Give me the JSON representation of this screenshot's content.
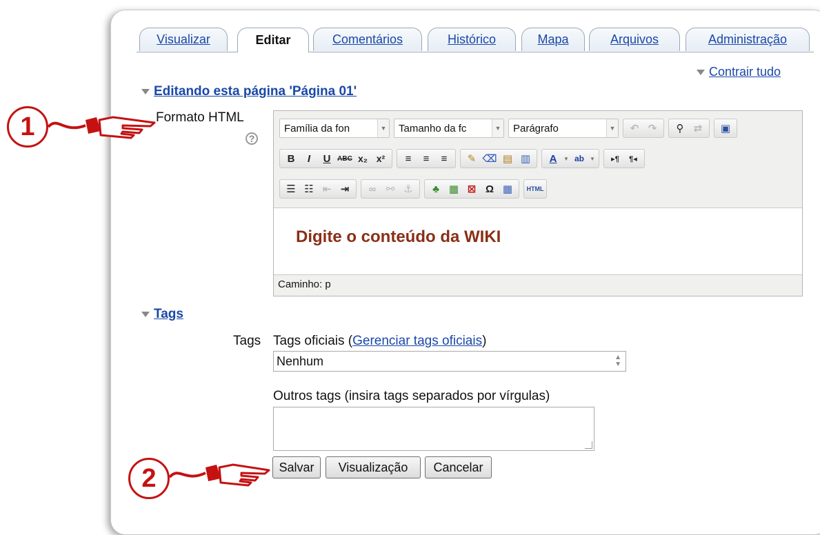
{
  "tabs": [
    {
      "label": "Visualizar"
    },
    {
      "label": "Editar"
    },
    {
      "label": "Comentários"
    },
    {
      "label": "Histórico"
    },
    {
      "label": "Mapa"
    },
    {
      "label": "Arquivos"
    },
    {
      "label": "Administração"
    }
  ],
  "collapse_all": "Contrair tudo",
  "section_edit": "Editando esta página 'Página 01'",
  "format_label": "Formato HTML",
  "editor": {
    "font_family": "Família da fon",
    "font_size": "Tamanho da fc",
    "paragraph": "Parágrafo",
    "html_button": "HTML",
    "content": "Digite o conteúdo da WIKI",
    "path": "Caminho: p"
  },
  "tags_section": "Tags",
  "tags_label": "Tags",
  "official_tags_label": "Tags oficiais (",
  "manage_tags_link": "Gerenciar tags oficiais",
  "official_tags_close": ")",
  "official_tags_value": "Nenhum",
  "other_tags_label": "Outros tags (insira tags separados por vírgulas)",
  "buttons": {
    "save": "Salvar",
    "preview": "Visualização",
    "cancel": "Cancelar"
  },
  "callouts": [
    "1",
    "2"
  ],
  "colors": {
    "link": "#1a48a8",
    "callout": "#c41212",
    "content_text": "#8a2f17"
  }
}
